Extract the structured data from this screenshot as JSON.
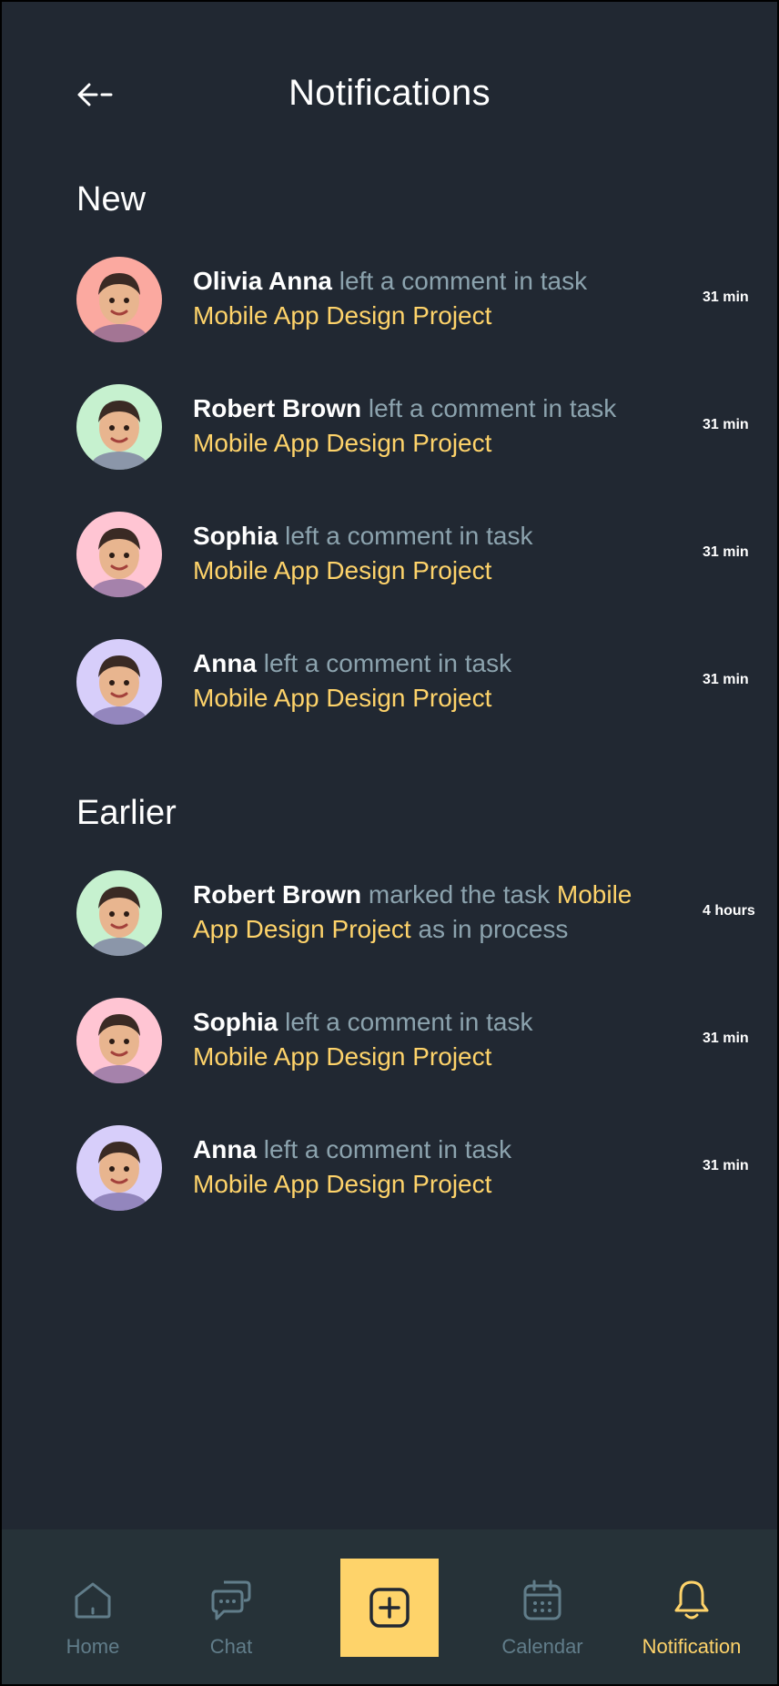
{
  "header": {
    "title": "Notifications"
  },
  "sections": {
    "new_title": "New",
    "earlier_title": "Earlier"
  },
  "new_items": [
    {
      "name": "Olivia Anna",
      "action": " left a comment in task",
      "task": "Mobile App Design Project",
      "time": "31 min",
      "avatar_bg": "#FBA9A0"
    },
    {
      "name": "Robert Brown",
      "action": " left a comment in task",
      "task": "Mobile App Design Project",
      "time": "31 min",
      "avatar_bg": "#C6F1CF"
    },
    {
      "name": "Sophia",
      "action": " left a comment in task",
      "task": "Mobile App Design Project",
      "time": "31 min",
      "avatar_bg": "#FFC5D3"
    },
    {
      "name": "Anna",
      "action": " left a comment in task",
      "task": "Mobile App Design Project",
      "time": "31 min",
      "avatar_bg": "#D7CEFA"
    }
  ],
  "earlier_items": [
    {
      "name": "Robert Brown",
      "action": " marked the task ",
      "task": "Mobile App Design Project",
      "suffix": " as in process",
      "time": "4 hours",
      "avatar_bg": "#C6F1CF"
    },
    {
      "name": "Sophia",
      "action": " left a comment in task",
      "task": "Mobile App Design Project",
      "time": "31 min",
      "avatar_bg": "#FFC5D3"
    },
    {
      "name": "Anna",
      "action": " left a comment in task",
      "task": "Mobile App Design Project",
      "time": "31 min",
      "avatar_bg": "#D7CEFA"
    }
  ],
  "nav": {
    "home": "Home",
    "chat": "Chat",
    "calendar": "Calendar",
    "notification": "Notification"
  },
  "colors": {
    "background": "#212832",
    "accent": "#FED36A",
    "muted": "#8CA3AE",
    "nav_bg": "#263238",
    "nav_inactive": "#617D8A"
  }
}
